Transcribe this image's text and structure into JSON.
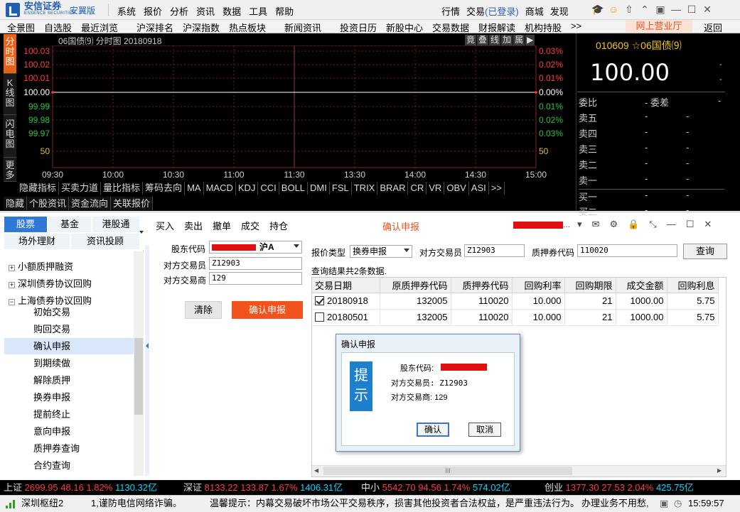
{
  "app": {
    "brand": "安信证券",
    "brand_sub": "ESSENCE SECURITIES",
    "edition": "安翼版",
    "main_menu": [
      "系统",
      "报价",
      "分析",
      "资讯",
      "数据",
      "工具",
      "帮助"
    ],
    "right_menu": {
      "market": "行情",
      "trade": "交易",
      "login_status": "(已登录)",
      "mall": "商城",
      "discover": "发现"
    }
  },
  "nav": {
    "items": [
      "全景图",
      "自选股",
      "最近浏览",
      "沪深排名",
      "沪深指数",
      "热点板块",
      "新闻资讯",
      "投资日历",
      "新股中心",
      "交易数据",
      "财报解读",
      "机构持股",
      ">>"
    ],
    "online_hall": "网上营业厅",
    "back": "返回"
  },
  "chart": {
    "left_tabs": [
      "分时图",
      "K线图",
      "闪电图",
      "更多"
    ],
    "title": "06国债⑼ 分时图 20180918",
    "buttons": [
      "竟",
      "叠",
      "线",
      "加",
      "属",
      "▶"
    ],
    "indicators": [
      "隐藏指标",
      "买卖力道",
      "量比指标",
      "筹码去向",
      "MA",
      "MACD",
      "KDJ",
      "CCI",
      "BOLL",
      "DMI",
      "FSL",
      "TRIX",
      "BRAR",
      "CR",
      "VR",
      "OBV",
      "ASI",
      ">>"
    ],
    "bottom_tabs": [
      "隐藏",
      "个股资讯",
      "资金流向",
      "关联报价"
    ]
  },
  "chart_data": {
    "type": "line",
    "title": "06国债⑼ 分时图 20180918",
    "x_ticks": [
      "09:30",
      "10:00",
      "10:30",
      "11:00",
      "11:30",
      "13:30",
      "14:00",
      "14:30",
      "15:00"
    ],
    "y_left_ticks": [
      "100.03",
      "100.02",
      "100.01",
      "100.00",
      "99.99",
      "99.98",
      "99.97",
      "50"
    ],
    "y_right_ticks": [
      "0.03%",
      "0.02%",
      "0.01%",
      "0.00%",
      "0.01%",
      "0.02%",
      "0.03%",
      "50"
    ],
    "ylim": [
      99.965,
      100.035
    ],
    "series": [
      {
        "x": [
          "09:30",
          "15:00"
        ],
        "y": [
          100.0,
          100.0
        ]
      }
    ],
    "colors": {
      "up": "#ff3c3c",
      "down": "#23c43c",
      "base": "#ffffff"
    }
  },
  "quote": {
    "code_line": "010609 ☆06国债⑼",
    "price": "100.00",
    "dash": "-",
    "weibi_label": "委比",
    "weicha_label": "- 委差",
    "sell": [
      "卖五",
      "卖四",
      "卖三",
      "卖二",
      "卖一"
    ],
    "buy": [
      "买一",
      "买二"
    ]
  },
  "categories": [
    "股票",
    "基金",
    "港股通",
    "场外理财",
    "资讯投顾"
  ],
  "tree": {
    "groups": [
      "小额质押融资",
      "深圳债券协议回购",
      "上海债券协议回购"
    ],
    "items": [
      "初始交易",
      "购回交易",
      "确认申报",
      "到期续做",
      "解除质押",
      "换券申报",
      "提前终止",
      "意向申报",
      "质押券查询",
      "合约查询"
    ],
    "selected": "确认申报"
  },
  "trade_toolbar": [
    "买入",
    "卖出",
    "撤单",
    "成交",
    "持仓"
  ],
  "page_title": "确认申报",
  "acct_dots": "...",
  "form": {
    "holder_label": "股东代码",
    "holder_market": "沪A",
    "counterparty_trader_label": "对方交易员",
    "counterparty_trader": "Z12903",
    "counterparty_firm_label": "对方交易商",
    "counterparty_firm": "129",
    "clear_label": "清除",
    "confirm_label": "确认申报"
  },
  "query": {
    "quote_type_label": "报价类型",
    "quote_type": "换券申报",
    "trader_label": "对方交易员",
    "trader": "Z12903",
    "pledge_code_label": "质押券代码",
    "pledge_code": "110020",
    "query_label": "查询",
    "result_count": "查询结果共2条数据."
  },
  "table": {
    "columns": [
      "交易日期",
      "原质押券代码",
      "质押券代码",
      "回购利率",
      "回购期限",
      "成交金额",
      "回购利息"
    ],
    "rows": [
      {
        "checked": true,
        "cells": [
          "20180918",
          "132005",
          "110020",
          "10.000",
          "21",
          "1000.00",
          "5.75"
        ]
      },
      {
        "checked": false,
        "cells": [
          "20180501",
          "132005",
          "110020",
          "10.000",
          "21",
          "1000.00",
          "5.75"
        ]
      }
    ],
    "hscroll_grip": "III"
  },
  "dialog": {
    "title": "确认申报",
    "hint": "提示",
    "holder_label": "股东代码:",
    "trader_line": "对方交易员: Z12903",
    "firm_line": "对方交易商: 129",
    "ok_label": "确认",
    "cancel_label": "取消"
  },
  "ticker": [
    {
      "name": "上证",
      "price": "2699.95",
      "chg": "48.16",
      "pct": "1.82%",
      "amt": "1130.32亿"
    },
    {
      "name": "深证",
      "price": "8133.22",
      "chg": "133.87",
      "pct": "1.67%",
      "amt": "1406.31亿"
    },
    {
      "name": "中小",
      "price": "5542.70",
      "chg": "94.56",
      "pct": "1.74%",
      "amt": "574.02亿"
    },
    {
      "name": "创业",
      "price": "1377.30",
      "chg": "27.53",
      "pct": "2.04%",
      "amt": "425.75亿"
    }
  ],
  "status": {
    "server": "深圳枢纽2",
    "message1": "1,谨防电信网络诈骗。",
    "message2": "温馨提示：内幕交易破坏市场公平交易秩序，损害其他投资者合法权益，是严重违法行为。",
    "message3": "办理业务不用愁,",
    "time": "15:59:57"
  }
}
